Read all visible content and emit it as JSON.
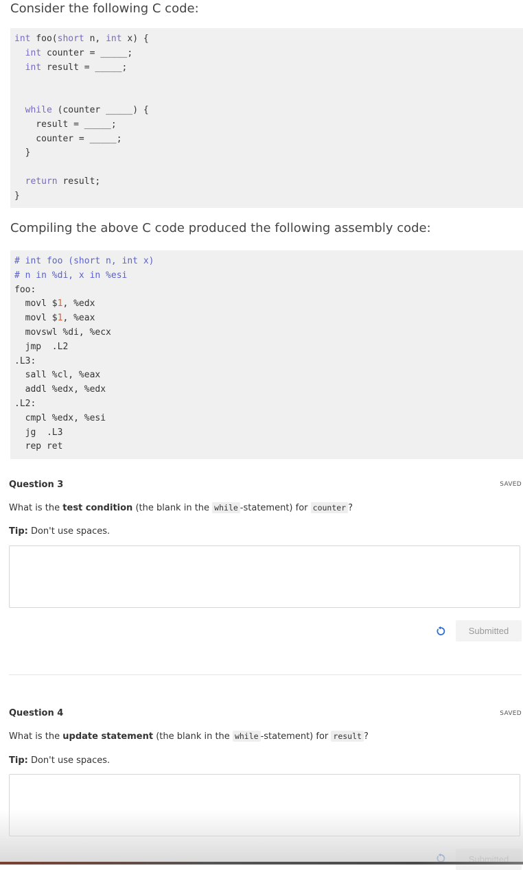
{
  "intro_heading": "Consider the following C code:",
  "c_code_lines": [
    [
      "int",
      " foo(",
      "short",
      " n, ",
      "int",
      " x) {"
    ],
    [
      "  ",
      "int",
      " counter = _____;"
    ],
    [
      "  ",
      "int",
      " result = _____;"
    ],
    [
      ""
    ],
    [
      ""
    ],
    [
      "  ",
      "while",
      " (counter _____) {"
    ],
    [
      "    result = _____;"
    ],
    [
      "    counter = _____;"
    ],
    [
      "  }"
    ],
    [
      ""
    ],
    [
      "  ",
      "return",
      " result;"
    ],
    [
      "}"
    ]
  ],
  "asm_heading": "Compiling the above C code produced the following assembly code:",
  "asm_lines": [
    "# int foo (short n, int x)",
    "# n in %di, x in %esi",
    "foo:",
    "  movl $1, %edx",
    "  movl $1, %eax",
    "  movswl %di, %ecx",
    "  jmp  .L2",
    ".L3:",
    "  sall %cl, %eax",
    "  addl %edx, %edx",
    ".L2:",
    "  cmpl %edx, %esi",
    "  jg  .L3",
    "  rep ret"
  ],
  "q3": {
    "title": "Question 3",
    "status": "SAVED",
    "text_before": "What is the ",
    "text_bold": "test condition",
    "text_middle": " (the blank in the ",
    "code_while": "while",
    "text_after": "-statement) for ",
    "code_var": "counter",
    "text_end": "?",
    "tip_label": "Tip:",
    "tip_text": " Don't use spaces.",
    "answer": "",
    "button_label": "Submitted"
  },
  "q4": {
    "title": "Question 4",
    "status": "SAVED",
    "text_before": "What is the ",
    "text_bold": "update statement",
    "text_middle": " (the blank in the ",
    "code_while": "while",
    "text_after": "-statement) for ",
    "code_var": "result",
    "text_end": "?",
    "tip_label": "Tip:",
    "tip_text": " Don't use spaces.",
    "answer": "",
    "button_label": "Submitted"
  },
  "colors": {
    "keyword": "#7a67c4",
    "comment": "#5b62c9",
    "number": "#d0623c",
    "reset_icon": "#2a6fd6"
  },
  "icons": {
    "reset": "reset-icon"
  }
}
